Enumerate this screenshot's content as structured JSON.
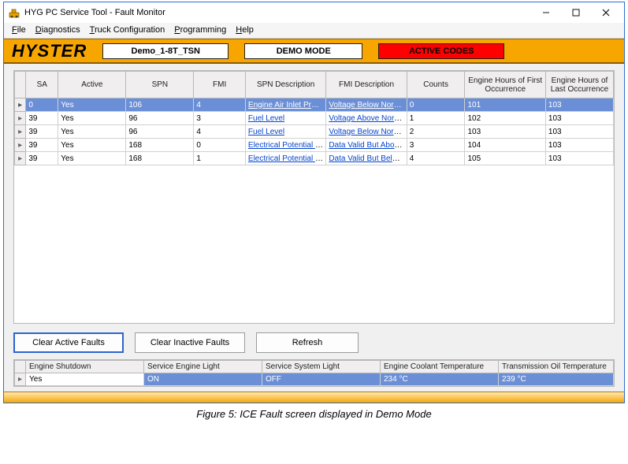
{
  "window": {
    "title": "HYG PC Service Tool - Fault Monitor",
    "min_icon": "minimize-icon",
    "max_icon": "maximize-icon",
    "close_icon": "close-icon"
  },
  "menu": {
    "file": "File",
    "diagnostics": "Diagnostics",
    "truck_config": "Truck Configuration",
    "programming": "Programming",
    "help": "Help"
  },
  "brand": {
    "logo": "HYSTER",
    "truck": "Demo_1-8T_TSN",
    "mode": "DEMO MODE",
    "codes": "ACTIVE CODES"
  },
  "grid": {
    "headers": {
      "rowhdr": "",
      "sa": "SA",
      "active": "Active",
      "spn": "SPN",
      "fmi": "FMI",
      "spn_desc": "SPN Description",
      "fmi_desc": "FMI Description",
      "counts": "Counts",
      "eh_first": "Engine Hours of First Occurrence",
      "eh_last": "Engine Hours of Last Occurrence"
    },
    "rows": [
      {
        "selected": true,
        "sa": "0",
        "active": "Yes",
        "spn": "106",
        "fmi": "4",
        "spn_desc": "Engine Air Inlet Press...",
        "fmi_desc": "Voltage Below Normal...",
        "counts": "0",
        "eh_first": "101",
        "eh_last": "103"
      },
      {
        "selected": false,
        "sa": "39",
        "active": "Yes",
        "spn": "96",
        "fmi": "3",
        "spn_desc": "Fuel Level",
        "fmi_desc": "Voltage Above Norma...",
        "counts": "1",
        "eh_first": "102",
        "eh_last": "103"
      },
      {
        "selected": false,
        "sa": "39",
        "active": "Yes",
        "spn": "96",
        "fmi": "4",
        "spn_desc": "Fuel Level",
        "fmi_desc": "Voltage Below Normal...",
        "counts": "2",
        "eh_first": "103",
        "eh_last": "103"
      },
      {
        "selected": false,
        "sa": "39",
        "active": "Yes",
        "spn": "168",
        "fmi": "0",
        "spn_desc": "Electrical Potential (V...",
        "fmi_desc": "Data Valid But Above ...",
        "counts": "3",
        "eh_first": "104",
        "eh_last": "103"
      },
      {
        "selected": false,
        "sa": "39",
        "active": "Yes",
        "spn": "168",
        "fmi": "1",
        "spn_desc": "Electrical Potential (V...",
        "fmi_desc": "Data Valid But Below ...",
        "counts": "4",
        "eh_first": "105",
        "eh_last": "103"
      }
    ]
  },
  "buttons": {
    "clear_active": "Clear Active Faults",
    "clear_inactive": "Clear Inactive Faults",
    "refresh": "Refresh"
  },
  "status": {
    "headers": {
      "shutdown": "Engine Shutdown",
      "sel": "Service Engine Light",
      "ssl": "Service System Light",
      "ect": "Engine Coolant Temperature",
      "tot": "Transmission Oil Temperature"
    },
    "values": {
      "shutdown": "Yes",
      "sel": "ON",
      "ssl": "OFF",
      "ect": "234 °C",
      "tot": "239 °C"
    }
  },
  "caption": "Figure 5: ICE Fault screen displayed in Demo Mode",
  "colors": {
    "brand_bg": "#f7a600",
    "select_bg": "#6b8fd6",
    "alert_bg": "#ff0000"
  }
}
